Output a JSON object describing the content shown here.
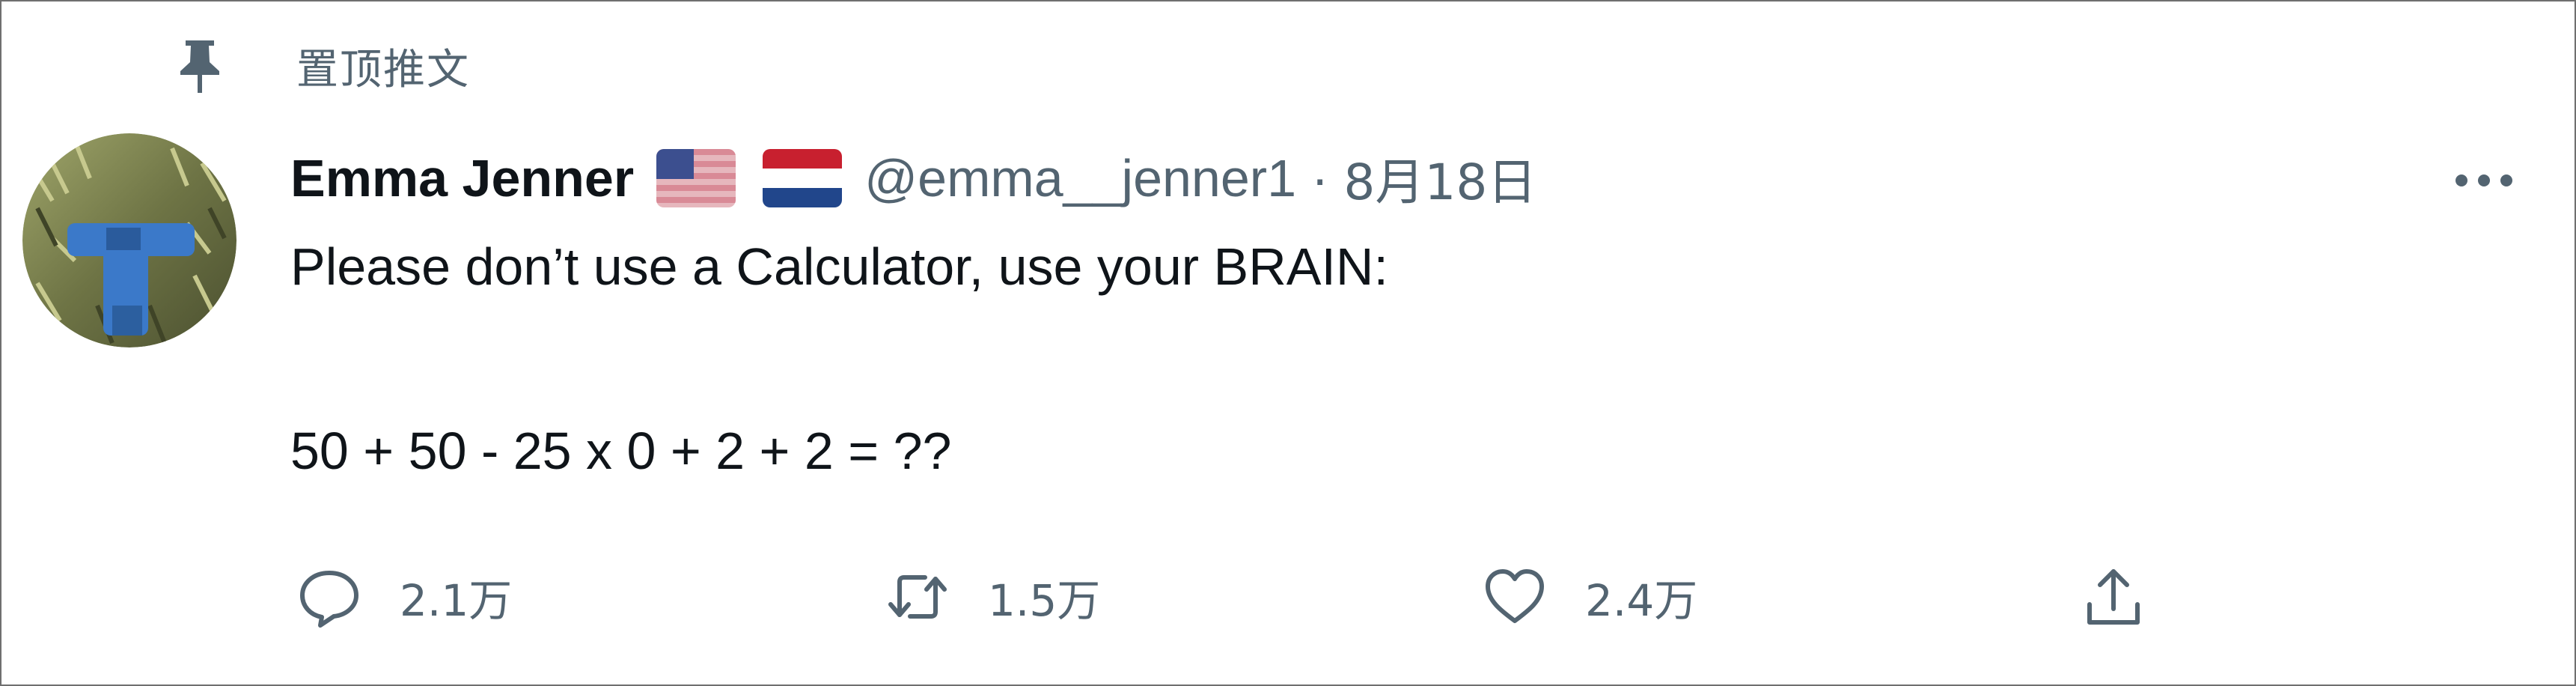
{
  "pinned": {
    "label": "置顶推文",
    "icon": "pin-icon"
  },
  "tweet": {
    "author": {
      "display_name": "Emma Jenner",
      "flags": [
        "us-flag-icon",
        "netherlands-flag-icon"
      ],
      "handle": "@emma__jenner1",
      "separator": "·",
      "timestamp": "8月18日"
    },
    "text_line1": "Please don’t use a Calculator, use your BRAIN:",
    "text_line2": "50 + 50 - 25 x 0 + 2 + 2 = ??",
    "more_icon": "more-options-icon"
  },
  "actions": {
    "reply": {
      "icon": "reply-icon",
      "count": "2.1万"
    },
    "retweet": {
      "icon": "retweet-icon",
      "count": "1.5万"
    },
    "like": {
      "icon": "heart-icon",
      "count": "2.4万"
    },
    "share": {
      "icon": "share-icon"
    }
  },
  "colors": {
    "text_primary": "#0f1419",
    "text_secondary": "#536471",
    "border": "#6f6f6f"
  }
}
